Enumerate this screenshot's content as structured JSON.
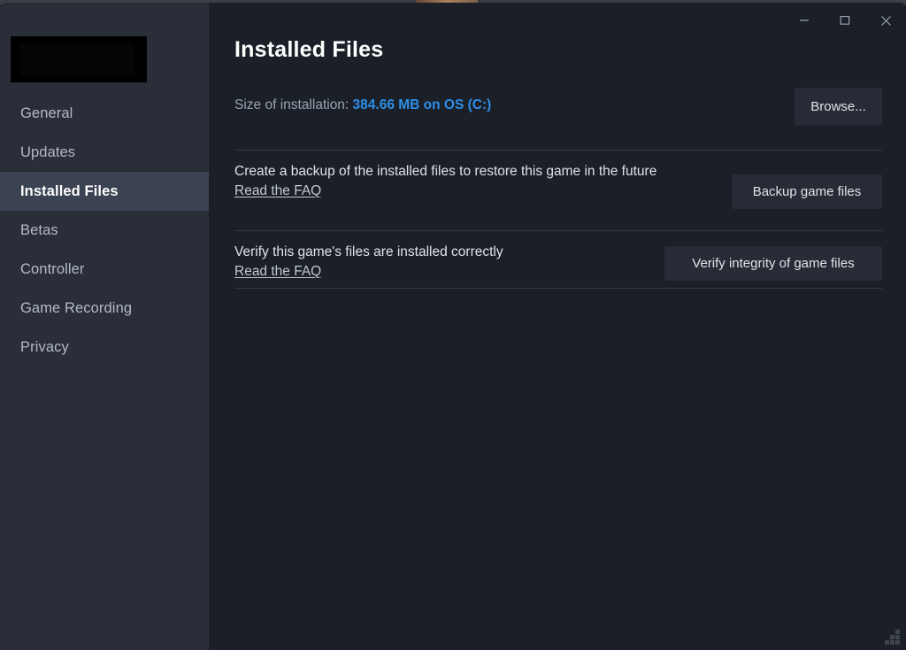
{
  "window": {
    "minimize_label": "Minimize",
    "maximize_label": "Maximize",
    "close_label": "Close"
  },
  "sidebar": {
    "game_title_redacted": "",
    "items": [
      {
        "label": "General",
        "selected": false
      },
      {
        "label": "Updates",
        "selected": false
      },
      {
        "label": "Installed Files",
        "selected": true
      },
      {
        "label": "Betas",
        "selected": false
      },
      {
        "label": "Controller",
        "selected": false
      },
      {
        "label": "Game Recording",
        "selected": false
      },
      {
        "label": "Privacy",
        "selected": false
      }
    ]
  },
  "main": {
    "page_title": "Installed Files",
    "size_row": {
      "label": "Size of installation: ",
      "value": "384.66 MB on OS (C:)",
      "browse_label": "Browse..."
    },
    "backup_row": {
      "description": "Create a backup of the installed files to restore this game in the future",
      "faq_label": "Read the FAQ",
      "button_label": "Backup game files"
    },
    "verify_row": {
      "description": "Verify this game's files are installed correctly",
      "faq_label": "Read the FAQ",
      "button_label": "Verify integrity of game files"
    }
  },
  "colors": {
    "accent_blue": "#2e8fe6",
    "sidebar_bg": "#2a2e39",
    "content_bg": "#1a1f28",
    "selected_bg": "#3b4252",
    "button_bg": "#262b35"
  }
}
